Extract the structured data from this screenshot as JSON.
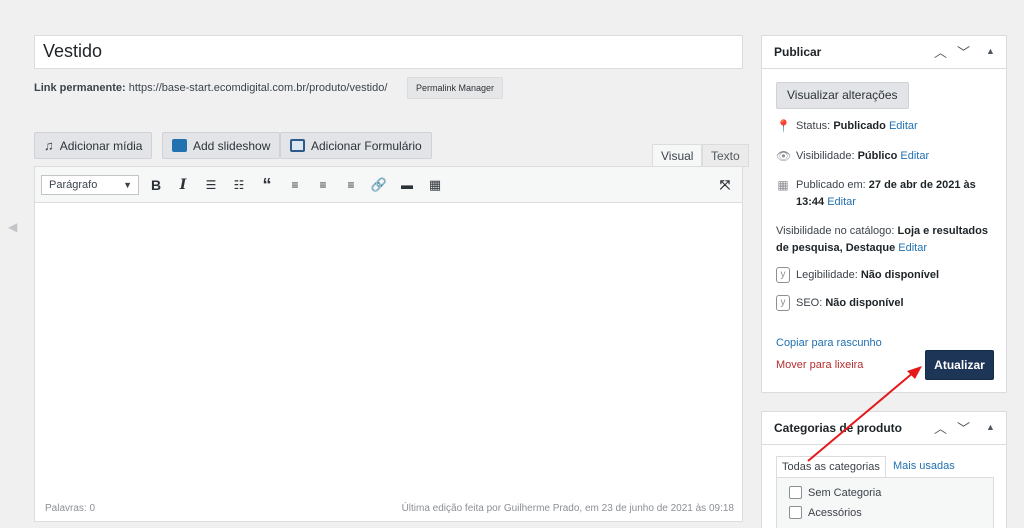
{
  "post": {
    "title": "Vestido",
    "permalink_label": "Link permanente:",
    "permalink_url": "https://base-start.ecomdigital.com.br/produto/vestido/",
    "permalink_manager": "Permalink Manager"
  },
  "media_buttons": {
    "add_media": "Adicionar mídia",
    "add_slideshow": "Add slideshow",
    "add_form": "Adicionar Formulário"
  },
  "editor": {
    "tab_visual": "Visual",
    "tab_text": "Texto",
    "format_value": "Parágrafo",
    "word_count": "Palavras: 0",
    "last_edit": "Última edição feita por Guilherme Prado, em 23 de junho de 2021 às 09:18"
  },
  "publish": {
    "title": "Publicar",
    "preview_btn": "Visualizar alterações",
    "status_label": "Status:",
    "status_value": "Publicado",
    "edit": "Editar",
    "visibility_label": "Visibilidade:",
    "visibility_value": "Público",
    "published_label": "Publicado em:",
    "published_value_1": "27 de abr de 2021 às",
    "published_value_2": "13:44",
    "catalog_label": "Visibilidade no catálogo:",
    "catalog_value_1": "Loja e resultados",
    "catalog_value_2": "de pesquisa, Destaque",
    "readability_label": "Legibilidade:",
    "readability_value": "Não disponível",
    "seo_label": "SEO:",
    "seo_value": "Não disponível",
    "copy_draft": "Copiar para rascunho",
    "trash": "Mover para lixeira",
    "update_btn": "Atualizar"
  },
  "categories": {
    "title": "Categorias de produto",
    "tab_all": "Todas as categorias",
    "tab_popular": "Mais usadas",
    "items": [
      "Sem Categoria",
      "Acessórios"
    ]
  },
  "colors": {
    "primary_button": "#1d3557",
    "annotation_arrow": "#e5191c",
    "link": "#2271b1",
    "trash": "#b32d2e"
  }
}
